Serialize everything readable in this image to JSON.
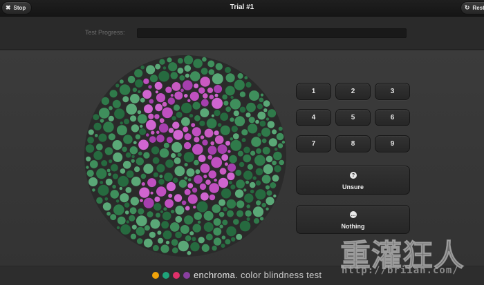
{
  "header": {
    "title": "Trial #1",
    "stop_label": "Stop",
    "restart_label": "Restart",
    "stop_icon": "close-icon",
    "restart_icon": "refresh-icon"
  },
  "progress": {
    "label": "Test Progress:",
    "value": 0
  },
  "plate": {
    "hidden_digit": "5",
    "figure_color": "#c050c0",
    "background_colors": [
      "#2f7a4a",
      "#3f8f5c",
      "#5aa877",
      "#266a3f"
    ]
  },
  "answers": {
    "numbers": [
      "1",
      "2",
      "3",
      "4",
      "5",
      "6",
      "7",
      "8",
      "9"
    ],
    "unsure": {
      "icon": "question-icon",
      "icon_glyph": "?",
      "label": "Unsure"
    },
    "nothing": {
      "icon": "ellipsis-icon",
      "icon_glyph": "…",
      "label": "Nothing"
    }
  },
  "footer": {
    "dots": [
      "#f0a30a",
      "#1fa37a",
      "#e0306a",
      "#8a3fa0"
    ],
    "brand_name": "enchroma",
    "brand_tagline": "color blindness test"
  },
  "watermark": {
    "text": "重灌狂人",
    "url": "http://briian.com/"
  }
}
